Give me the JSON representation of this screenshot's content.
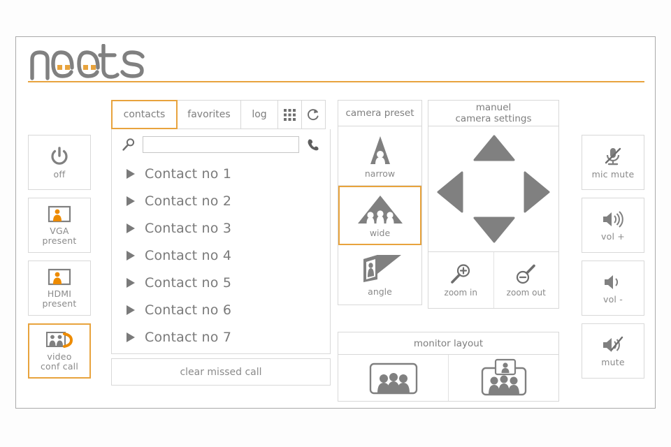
{
  "brand": {
    "name": "Neets",
    "accent": "#e8a33d",
    "gray": "#808080"
  },
  "left_rail": {
    "items": [
      {
        "id": "off",
        "label": "off",
        "icon": "power-icon",
        "selected": false
      },
      {
        "id": "vga",
        "label": "VGA\npresent",
        "icon": "vga-present-icon",
        "selected": false
      },
      {
        "id": "hdmi",
        "label": "HDMI\npresent",
        "icon": "hdmi-present-icon",
        "selected": false
      },
      {
        "id": "videocall",
        "label": "video\nconf call",
        "icon": "video-call-icon",
        "selected": true
      }
    ]
  },
  "right_rail": {
    "items": [
      {
        "id": "micmute",
        "label": "mic mute",
        "icon": "mic-mute-icon",
        "selected": false
      },
      {
        "id": "volup",
        "label": "vol +",
        "icon": "volume-up-icon",
        "selected": false
      },
      {
        "id": "voldown",
        "label": "vol -",
        "icon": "volume-down-icon",
        "selected": false
      },
      {
        "id": "mute",
        "label": "mute",
        "icon": "speaker-mute-icon",
        "selected": false
      }
    ]
  },
  "contacts": {
    "tabs": [
      {
        "id": "contacts",
        "label": "contacts",
        "selected": true
      },
      {
        "id": "favorites",
        "label": "favorites",
        "selected": false
      },
      {
        "id": "log",
        "label": "log",
        "selected": false
      }
    ],
    "tab_icons": [
      {
        "id": "keypad",
        "icon": "keypad-grid-icon"
      },
      {
        "id": "refresh",
        "icon": "refresh-icon"
      }
    ],
    "search": {
      "value": "",
      "placeholder": "",
      "icon": "search-icon",
      "call_icon": "phone-handset-icon"
    },
    "items": [
      "Contact no 1",
      "Contact no 2",
      "Contact no 3",
      "Contact no 4",
      "Contact no 5",
      "Contact no 6",
      "Contact no 7"
    ],
    "clear_label": "clear missed call"
  },
  "camera_preset": {
    "title": "camera preset",
    "items": [
      {
        "id": "narrow",
        "label": "narrow",
        "icon": "camera-narrow-icon",
        "selected": false
      },
      {
        "id": "wide",
        "label": "wide",
        "icon": "camera-wide-icon",
        "selected": true
      },
      {
        "id": "angle",
        "label": "angle",
        "icon": "camera-angle-icon",
        "selected": false
      }
    ]
  },
  "manual_camera": {
    "title_line1": "manuel",
    "title_line2": "camera settings",
    "dpad": [
      {
        "id": "up",
        "icon": "arrow-up-icon"
      },
      {
        "id": "left",
        "icon": "arrow-left-icon"
      },
      {
        "id": "right",
        "icon": "arrow-right-icon"
      },
      {
        "id": "down",
        "icon": "arrow-down-icon"
      }
    ],
    "zoom_in": {
      "label": "zoom in",
      "icon": "zoom-in-icon"
    },
    "zoom_out": {
      "label": "zoom out",
      "icon": "zoom-out-icon"
    }
  },
  "monitor_layout": {
    "title": "monitor layout",
    "items": [
      {
        "id": "fullscreen",
        "icon": "monitor-single-icon",
        "selected": false
      },
      {
        "id": "pip",
        "icon": "monitor-pip-icon",
        "selected": false
      }
    ]
  }
}
